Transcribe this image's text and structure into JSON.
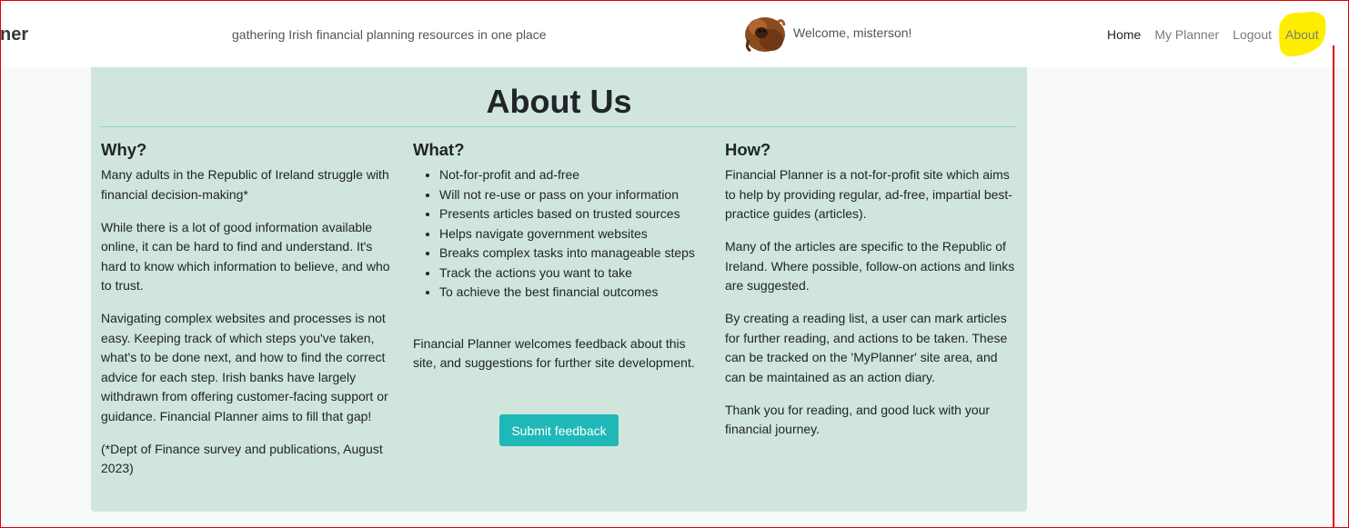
{
  "header": {
    "brand_fragment": "ner",
    "tagline": "gathering Irish financial planning resources in one place",
    "welcome": "Welcome, misterson!",
    "avatar_icon": "orangutan-avatar-icon",
    "nav": {
      "home": "Home",
      "my_planner": "My Planner",
      "logout": "Logout",
      "about": "About"
    },
    "highlight_color": "#ffee00"
  },
  "about": {
    "title": "About Us",
    "why": {
      "heading": "Why?",
      "paragraphs": [
        "Many adults in the Republic of Ireland struggle with financial decision-making*",
        "While there is a lot of good information available online, it can be hard to find and understand. It's hard to know which information to believe, and who to trust.",
        "Navigating complex websites and processes is not easy. Keeping track of which steps you've taken, what's to be done next, and how to find the correct advice for each step. Irish banks have largely withdrawn from offering customer-facing support or guidance. Financial Planner aims to fill that gap!",
        "(*Dept of Finance survey and publications, August 2023)"
      ]
    },
    "what": {
      "heading": "What?",
      "items": [
        "Not-for-profit and ad-free",
        "Will not re-use or pass on your information",
        "Presents articles based on trusted sources",
        "Helps navigate government websites",
        "Breaks complex tasks into manageable steps",
        "Track the actions you want to take",
        "To achieve the best financial outcomes"
      ],
      "feedback_text": "Financial Planner welcomes feedback about this site, and suggestions for further site development.",
      "submit_label": "Submit feedback"
    },
    "how": {
      "heading": "How?",
      "paragraphs": [
        "Financial Planner is a not-for-profit site which aims to help by providing regular, ad-free, impartial best-practice guides (articles).",
        "Many of the articles are specific to the Republic of Ireland. Where possible, follow-on actions and links are suggested.",
        "By creating a reading list, a user can mark articles for further reading, and actions to be taken. These can be tracked on the 'MyPlanner' site area, and can be maintained as an action diary.",
        "Thank you for reading, and good luck with your financial journey."
      ]
    }
  },
  "colors": {
    "card_background": "#d0e5dc",
    "button": "#1fb7b7",
    "frame": "#e00000"
  }
}
